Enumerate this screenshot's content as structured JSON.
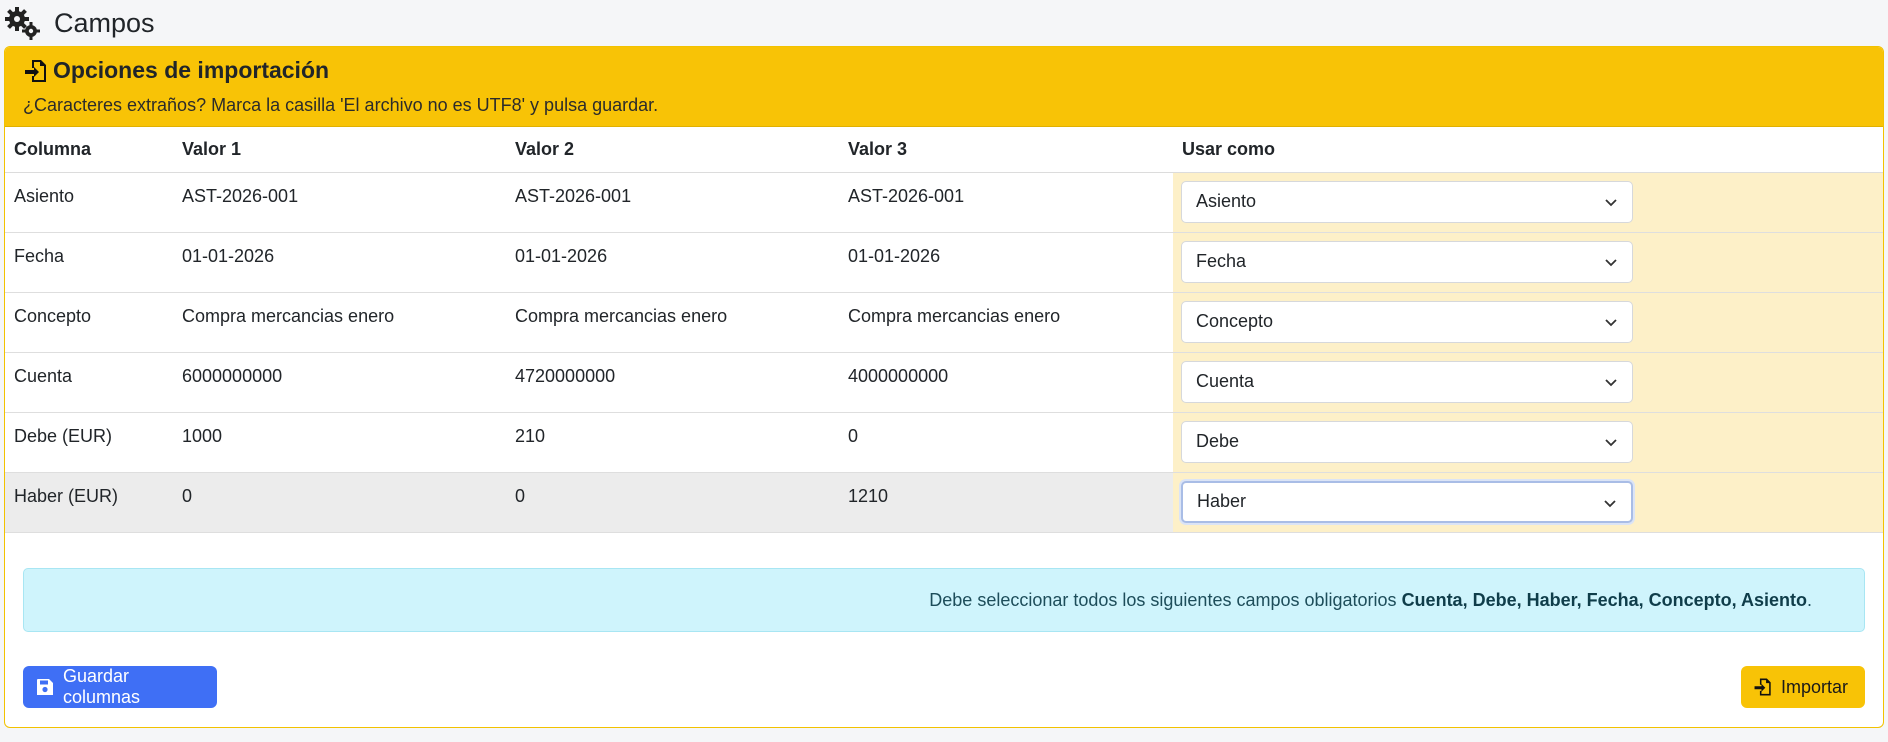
{
  "header": {
    "icon": "gears-icon",
    "title": "Campos"
  },
  "card": {
    "title_icon": "file-import-icon",
    "title": "Opciones de importación",
    "subtitle": "¿Caracteres extraños? Marca la casilla 'El archivo no es UTF8' y pulsa guardar."
  },
  "table": {
    "headers": [
      "Columna",
      "Valor 1",
      "Valor 2",
      "Valor 3",
      "Usar como"
    ],
    "rows": [
      {
        "col": "Asiento",
        "v1": "AST-2026-001",
        "v2": "AST-2026-001",
        "v3": "AST-2026-001",
        "use": "Asiento"
      },
      {
        "col": "Fecha",
        "v1": "01-01-2026",
        "v2": "01-01-2026",
        "v3": "01-01-2026",
        "use": "Fecha"
      },
      {
        "col": "Concepto",
        "v1": "Compra mercancias enero",
        "v2": "Compra mercancias enero",
        "v3": "Compra mercancias enero",
        "use": "Concepto"
      },
      {
        "col": "Cuenta",
        "v1": "6000000000",
        "v2": "4720000000",
        "v3": "4000000000",
        "use": "Cuenta"
      },
      {
        "col": "Debe (EUR)",
        "v1": "1000",
        "v2": "210",
        "v3": "0",
        "use": "Debe"
      },
      {
        "col": "Haber (EUR)",
        "v1": "0",
        "v2": "0",
        "v3": "1210",
        "use": "Haber"
      }
    ]
  },
  "alert": {
    "prefix": "Debe seleccionar todos los siguientes campos obligatorios ",
    "fields": "Cuenta, Debe, Haber, Fecha, Concepto, Asiento",
    "suffix": "."
  },
  "buttons": {
    "save_label": "Guardar columnas",
    "save_icon": "floppy-disk-icon",
    "import_label": "Importar",
    "import_icon": "file-import-icon"
  },
  "colors": {
    "warning": "#f8c306",
    "primary": "#3f6ff5",
    "info_bg": "#cff4fc"
  }
}
